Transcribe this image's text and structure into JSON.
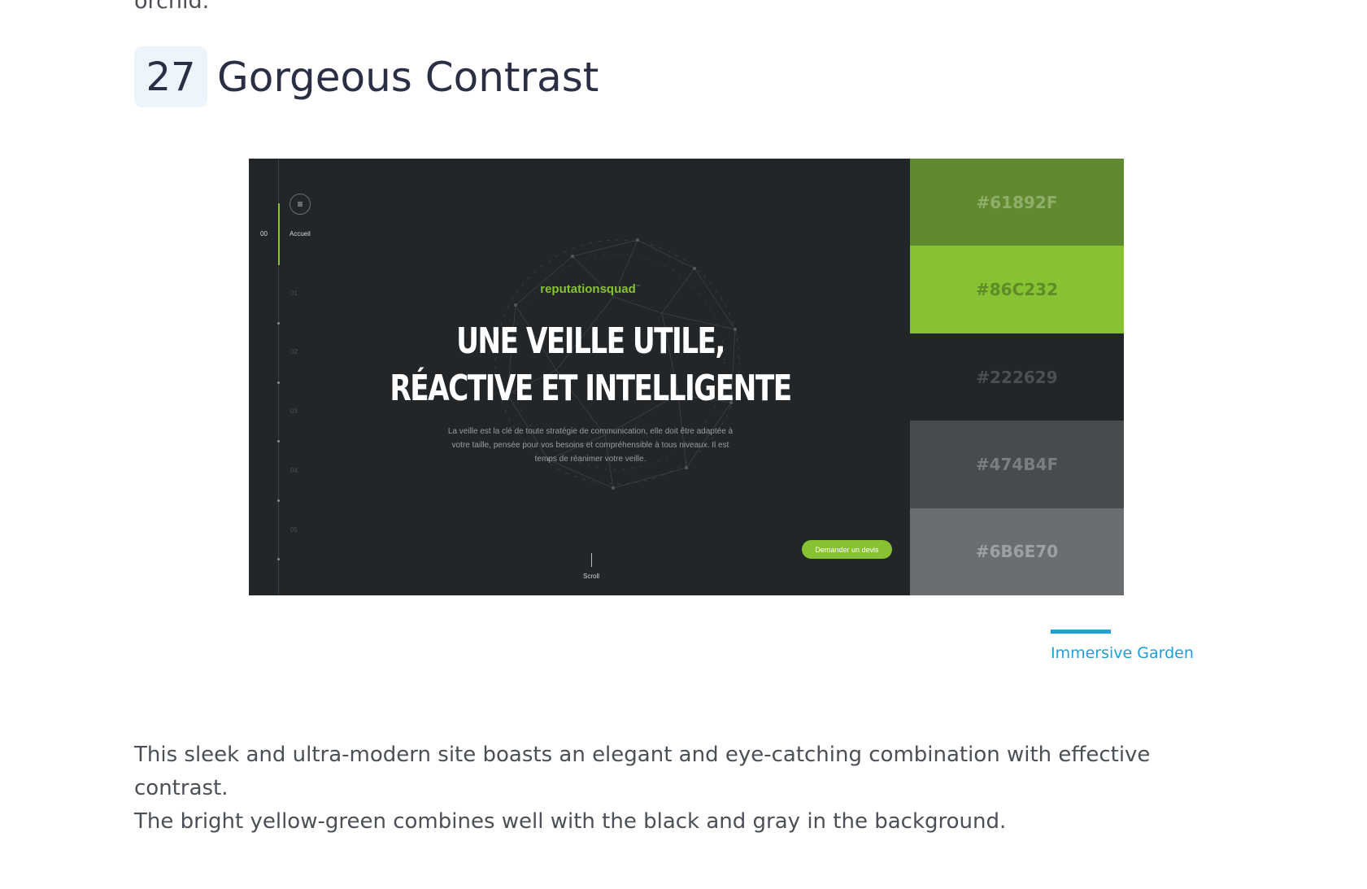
{
  "prev_text": "orchid.",
  "section": {
    "number": "27",
    "title": "Gorgeous Contrast"
  },
  "screenshot": {
    "nav": {
      "active_num": "00",
      "active_label": "Accueil",
      "items": [
        "01",
        "02",
        "03",
        "04",
        "05"
      ]
    },
    "brand": "reputationsquad",
    "brand_tm": "™",
    "hero_line1": "UNE VEILLE UTILE,",
    "hero_line2": "RÉACTIVE ET INTELLIGENTE",
    "lead": "La veille est la clé de toute stratégie de communication, elle doit être adaptée à votre taille, pensée pour vos besoins et compréhensible à tous niveaux. Il est temps de réanimer votre veille.",
    "cta_label": "Demander un devis",
    "scroll_label": "Scroll",
    "menu_icon": "hamburger-icon"
  },
  "palette": [
    {
      "label": "#61892F",
      "bg": "#61892F",
      "text": "#8fae6a"
    },
    {
      "label": "#86C232",
      "bg": "#86C232",
      "text": "#5e8b25"
    },
    {
      "label": "#222629",
      "bg": "#222629",
      "text": "#4a4f54"
    },
    {
      "label": "#474B4F",
      "bg": "#474B4F",
      "text": "#7b7e81"
    },
    {
      "label": "#6B6E70",
      "bg": "#6B6E70",
      "text": "#9ea0a2"
    }
  ],
  "credit": "Immersive Garden",
  "paragraph_line1": "This sleek and ultra-modern site boasts an elegant and eye-catching combination with effective contrast.",
  "paragraph_line2": "The bright yellow-green combines well with the black and gray in the background."
}
